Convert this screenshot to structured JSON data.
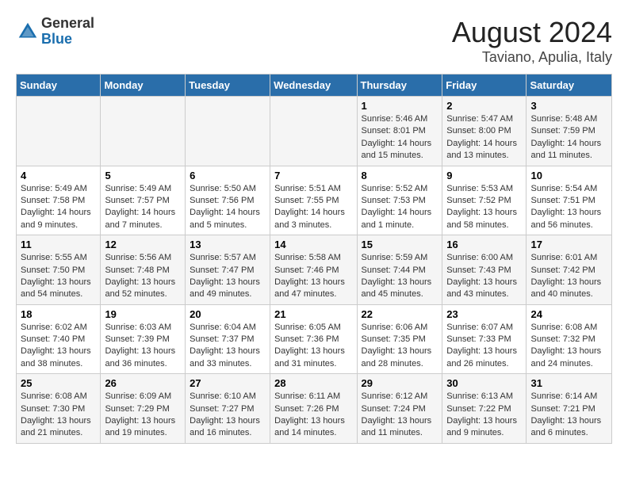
{
  "header": {
    "logo_general": "General",
    "logo_blue": "Blue",
    "month_title": "August 2024",
    "location": "Taviano, Apulia, Italy"
  },
  "weekdays": [
    "Sunday",
    "Monday",
    "Tuesday",
    "Wednesday",
    "Thursday",
    "Friday",
    "Saturday"
  ],
  "weeks": [
    [
      {
        "day": "",
        "info": ""
      },
      {
        "day": "",
        "info": ""
      },
      {
        "day": "",
        "info": ""
      },
      {
        "day": "",
        "info": ""
      },
      {
        "day": "1",
        "info": "Sunrise: 5:46 AM\nSunset: 8:01 PM\nDaylight: 14 hours\nand 15 minutes."
      },
      {
        "day": "2",
        "info": "Sunrise: 5:47 AM\nSunset: 8:00 PM\nDaylight: 14 hours\nand 13 minutes."
      },
      {
        "day": "3",
        "info": "Sunrise: 5:48 AM\nSunset: 7:59 PM\nDaylight: 14 hours\nand 11 minutes."
      }
    ],
    [
      {
        "day": "4",
        "info": "Sunrise: 5:49 AM\nSunset: 7:58 PM\nDaylight: 14 hours\nand 9 minutes."
      },
      {
        "day": "5",
        "info": "Sunrise: 5:49 AM\nSunset: 7:57 PM\nDaylight: 14 hours\nand 7 minutes."
      },
      {
        "day": "6",
        "info": "Sunrise: 5:50 AM\nSunset: 7:56 PM\nDaylight: 14 hours\nand 5 minutes."
      },
      {
        "day": "7",
        "info": "Sunrise: 5:51 AM\nSunset: 7:55 PM\nDaylight: 14 hours\nand 3 minutes."
      },
      {
        "day": "8",
        "info": "Sunrise: 5:52 AM\nSunset: 7:53 PM\nDaylight: 14 hours\nand 1 minute."
      },
      {
        "day": "9",
        "info": "Sunrise: 5:53 AM\nSunset: 7:52 PM\nDaylight: 13 hours\nand 58 minutes."
      },
      {
        "day": "10",
        "info": "Sunrise: 5:54 AM\nSunset: 7:51 PM\nDaylight: 13 hours\nand 56 minutes."
      }
    ],
    [
      {
        "day": "11",
        "info": "Sunrise: 5:55 AM\nSunset: 7:50 PM\nDaylight: 13 hours\nand 54 minutes."
      },
      {
        "day": "12",
        "info": "Sunrise: 5:56 AM\nSunset: 7:48 PM\nDaylight: 13 hours\nand 52 minutes."
      },
      {
        "day": "13",
        "info": "Sunrise: 5:57 AM\nSunset: 7:47 PM\nDaylight: 13 hours\nand 49 minutes."
      },
      {
        "day": "14",
        "info": "Sunrise: 5:58 AM\nSunset: 7:46 PM\nDaylight: 13 hours\nand 47 minutes."
      },
      {
        "day": "15",
        "info": "Sunrise: 5:59 AM\nSunset: 7:44 PM\nDaylight: 13 hours\nand 45 minutes."
      },
      {
        "day": "16",
        "info": "Sunrise: 6:00 AM\nSunset: 7:43 PM\nDaylight: 13 hours\nand 43 minutes."
      },
      {
        "day": "17",
        "info": "Sunrise: 6:01 AM\nSunset: 7:42 PM\nDaylight: 13 hours\nand 40 minutes."
      }
    ],
    [
      {
        "day": "18",
        "info": "Sunrise: 6:02 AM\nSunset: 7:40 PM\nDaylight: 13 hours\nand 38 minutes."
      },
      {
        "day": "19",
        "info": "Sunrise: 6:03 AM\nSunset: 7:39 PM\nDaylight: 13 hours\nand 36 minutes."
      },
      {
        "day": "20",
        "info": "Sunrise: 6:04 AM\nSunset: 7:37 PM\nDaylight: 13 hours\nand 33 minutes."
      },
      {
        "day": "21",
        "info": "Sunrise: 6:05 AM\nSunset: 7:36 PM\nDaylight: 13 hours\nand 31 minutes."
      },
      {
        "day": "22",
        "info": "Sunrise: 6:06 AM\nSunset: 7:35 PM\nDaylight: 13 hours\nand 28 minutes."
      },
      {
        "day": "23",
        "info": "Sunrise: 6:07 AM\nSunset: 7:33 PM\nDaylight: 13 hours\nand 26 minutes."
      },
      {
        "day": "24",
        "info": "Sunrise: 6:08 AM\nSunset: 7:32 PM\nDaylight: 13 hours\nand 24 minutes."
      }
    ],
    [
      {
        "day": "25",
        "info": "Sunrise: 6:08 AM\nSunset: 7:30 PM\nDaylight: 13 hours\nand 21 minutes."
      },
      {
        "day": "26",
        "info": "Sunrise: 6:09 AM\nSunset: 7:29 PM\nDaylight: 13 hours\nand 19 minutes."
      },
      {
        "day": "27",
        "info": "Sunrise: 6:10 AM\nSunset: 7:27 PM\nDaylight: 13 hours\nand 16 minutes."
      },
      {
        "day": "28",
        "info": "Sunrise: 6:11 AM\nSunset: 7:26 PM\nDaylight: 13 hours\nand 14 minutes."
      },
      {
        "day": "29",
        "info": "Sunrise: 6:12 AM\nSunset: 7:24 PM\nDaylight: 13 hours\nand 11 minutes."
      },
      {
        "day": "30",
        "info": "Sunrise: 6:13 AM\nSunset: 7:22 PM\nDaylight: 13 hours\nand 9 minutes."
      },
      {
        "day": "31",
        "info": "Sunrise: 6:14 AM\nSunset: 7:21 PM\nDaylight: 13 hours\nand 6 minutes."
      }
    ]
  ]
}
